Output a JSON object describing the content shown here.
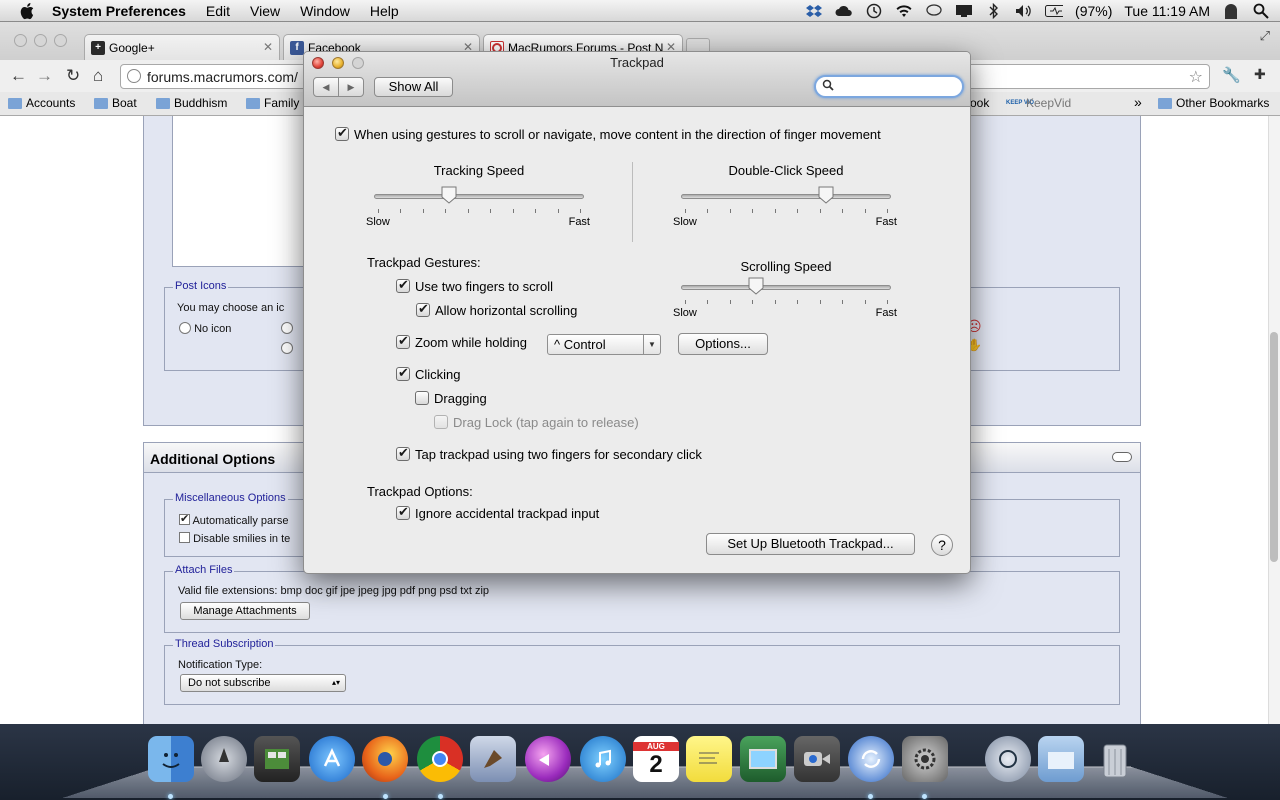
{
  "menubar": {
    "app_name": "System Preferences",
    "items": [
      "Edit",
      "View",
      "Window",
      "Help"
    ],
    "battery": "(97%)",
    "clock": "Tue 11:19 AM"
  },
  "browser": {
    "tabs": [
      {
        "title": "Google+",
        "close": "✕"
      },
      {
        "title": "Facebook",
        "close": "✕"
      },
      {
        "title": "MacRumors Forums - Post N",
        "close": "✕"
      }
    ],
    "url": "forums.macrumors.com/",
    "bookmarks": [
      "Accounts",
      "Boat",
      "Buddhism",
      "Family",
      "ook",
      "KeepVid"
    ],
    "keepvid_badge": "KEEP VID",
    "overflow": "»",
    "other_bookmarks": "Other Bookmarks"
  },
  "page": {
    "post_icons": {
      "legend": "Post Icons",
      "text": "You may choose an ic",
      "no_icon": "No icon"
    },
    "additional_options": {
      "title": "Additional Options",
      "misc": {
        "legend": "Miscellaneous Options",
        "opt1": "Automatically parse",
        "opt2": "Disable smilies in te"
      },
      "attach": {
        "legend": "Attach Files",
        "text": "Valid file extensions: bmp doc gif jpe jpeg jpg pdf png psd txt zip",
        "button": "Manage Attachments"
      },
      "subscription": {
        "legend": "Thread Subscription",
        "label": "Notification Type:",
        "value": "Do not subscribe"
      }
    }
  },
  "trackpad": {
    "title": "Trackpad",
    "show_all": "Show All",
    "search_placeholder": "",
    "natural_scroll": "When using gestures to scroll or navigate, move content in the direction of finger movement",
    "tracking_speed": {
      "label": "Tracking Speed",
      "slow": "Slow",
      "fast": "Fast",
      "value": 0.35
    },
    "double_click_speed": {
      "label": "Double-Click Speed",
      "slow": "Slow",
      "fast": "Fast",
      "value": 0.7
    },
    "scrolling_speed": {
      "label": "Scrolling Speed",
      "slow": "Slow",
      "fast": "Fast",
      "value": 0.35
    },
    "gestures_heading": "Trackpad Gestures:",
    "two_finger_scroll": "Use two fingers to scroll",
    "horizontal_scroll": "Allow horizontal scrolling",
    "zoom_holding": "Zoom while holding",
    "zoom_key": "^ Control",
    "options_button": "Options...",
    "clicking": "Clicking",
    "dragging": "Dragging",
    "drag_lock": "Drag Lock (tap again to release)",
    "secondary_click": "Tap trackpad using two fingers for secondary click",
    "options_heading": "Trackpad Options:",
    "ignore_accidental": "Ignore accidental trackpad input",
    "bluetooth_button": "Set Up Bluetooth Trackpad...",
    "help": "?"
  },
  "dock": {
    "calendar_month": "AUG",
    "calendar_day": "2"
  }
}
